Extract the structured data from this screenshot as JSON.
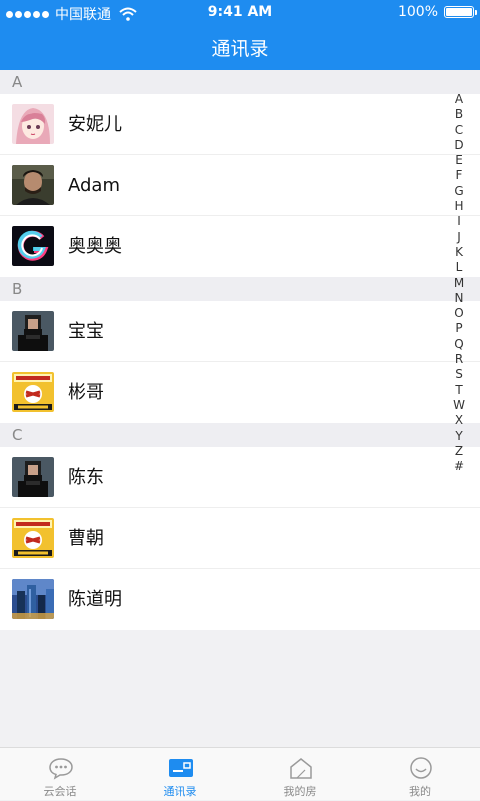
{
  "status_bar": {
    "carrier": "中国联通",
    "time": "9:41 AM",
    "battery": "100%",
    "battery_level": 1.0
  },
  "nav": {
    "title": "通讯录"
  },
  "sections": [
    {
      "header": "A",
      "contacts": [
        {
          "name": "安妮儿",
          "avatar": "anime-girl-avatar"
        },
        {
          "name": "Adam",
          "avatar": "man-photo-avatar"
        },
        {
          "name": "奥奥奥",
          "avatar": "g-logo-avatar"
        }
      ]
    },
    {
      "header": "B",
      "contacts": [
        {
          "name": "宝宝",
          "avatar": "pixel-person-avatar"
        },
        {
          "name": "彬哥",
          "avatar": "cigarette-pack-avatar"
        }
      ]
    },
    {
      "header": "C",
      "contacts": [
        {
          "name": "陈东",
          "avatar": "pixel-person-avatar"
        },
        {
          "name": "曹朝",
          "avatar": "cigarette-pack-avatar"
        },
        {
          "name": "陈道明",
          "avatar": "city-skyline-avatar"
        }
      ]
    }
  ],
  "index": [
    "A",
    "B",
    "C",
    "D",
    "E",
    "F",
    "G",
    "H",
    "I",
    "J",
    "K",
    "L",
    "M",
    "N",
    "O",
    "P",
    "Q",
    "R",
    "S",
    "T",
    "W",
    "X",
    "Y",
    "Z",
    "#"
  ],
  "tabs": [
    {
      "label": "云会话",
      "icon": "chat-bubble-icon",
      "active": false
    },
    {
      "label": "通讯录",
      "icon": "contacts-card-icon",
      "active": true
    },
    {
      "label": "我的房",
      "icon": "house-icon",
      "active": false
    },
    {
      "label": "我的",
      "icon": "smiley-icon",
      "active": false
    }
  ],
  "colors": {
    "primary": "#1e8cf0",
    "section_bg": "#eeeef2",
    "tab_inactive": "#8a8a8a"
  }
}
